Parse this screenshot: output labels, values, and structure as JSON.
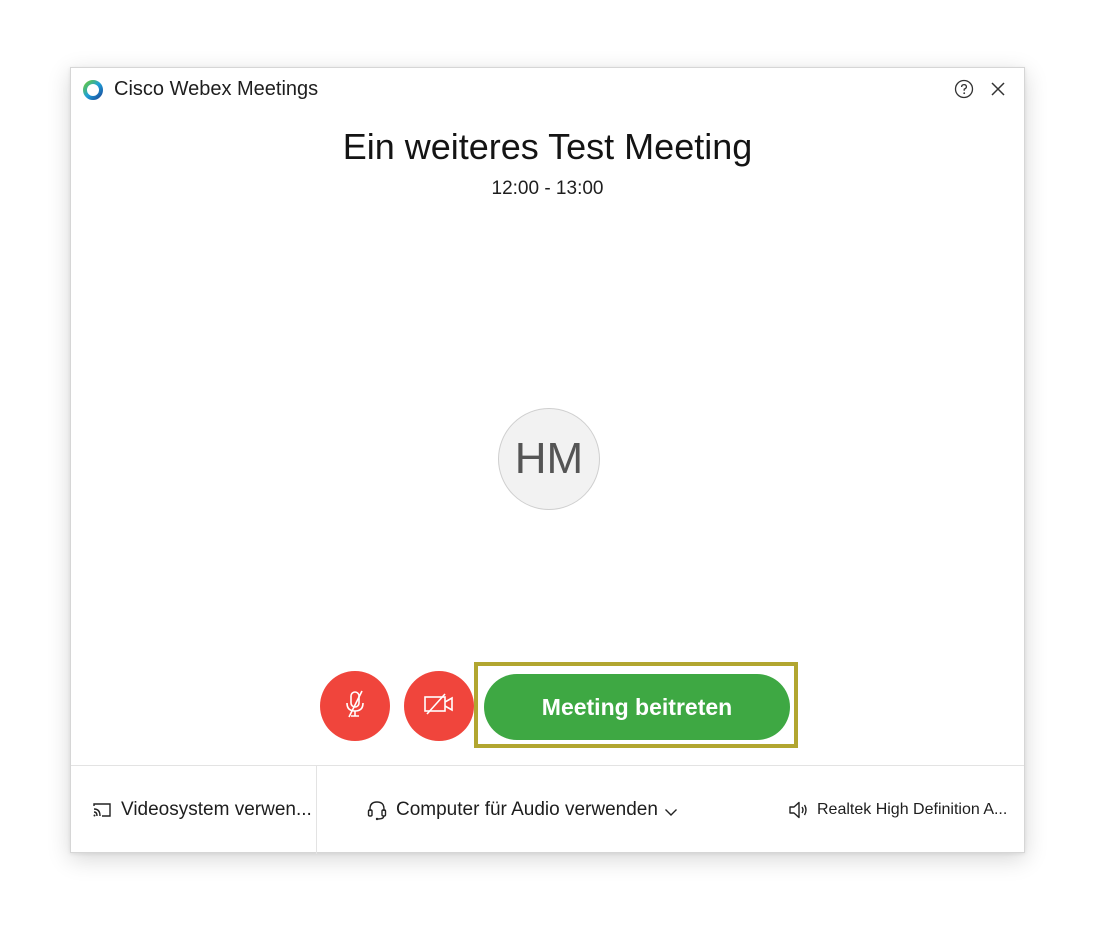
{
  "app": {
    "title": "Cisco Webex Meetings",
    "logo_icon": "webex-logo-icon",
    "help_icon": "help-icon",
    "close_icon": "close-icon"
  },
  "meeting": {
    "title": "Ein weiteres Test Meeting",
    "time": "12:00 - 13:00",
    "avatar_initials": "HM"
  },
  "controls": {
    "mute_icon": "microphone-muted-icon",
    "video_icon": "camera-off-icon",
    "join_label": "Meeting beitreten",
    "colors": {
      "control_red": "#f0453c",
      "join_green": "#3ea843",
      "highlight": "#b2a630"
    }
  },
  "footer": {
    "video_system_label": "Videosystem verwen...",
    "video_system_icon": "cast-screen-icon",
    "audio_label": "Computer für Audio verwenden",
    "audio_icon": "headset-icon",
    "speaker_label": "Realtek High Definition A...",
    "speaker_icon": "speaker-icon"
  }
}
